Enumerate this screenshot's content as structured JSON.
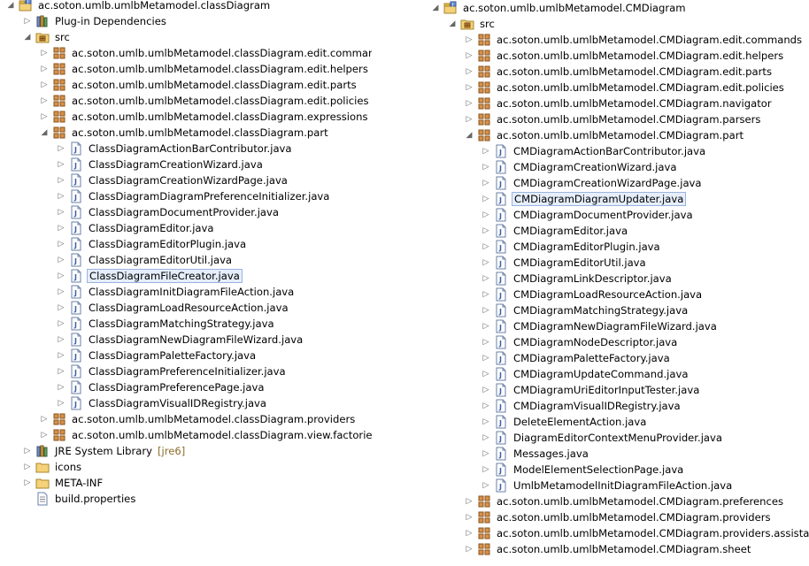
{
  "left": {
    "items": [
      {
        "depth": 0,
        "twisty": "expanded",
        "icon": "project",
        "label": "ac.soton.umlb.umlbMetamodel.classDiagram"
      },
      {
        "depth": 1,
        "twisty": "collapsed",
        "icon": "library",
        "label": "Plug-in Dependencies"
      },
      {
        "depth": 1,
        "twisty": "expanded",
        "icon": "source-folder",
        "label": "src"
      },
      {
        "depth": 2,
        "twisty": "collapsed",
        "icon": "package",
        "label": "ac.soton.umlb.umlbMetamodel.classDiagram.edit.commands"
      },
      {
        "depth": 2,
        "twisty": "collapsed",
        "icon": "package",
        "label": "ac.soton.umlb.umlbMetamodel.classDiagram.edit.helpers"
      },
      {
        "depth": 2,
        "twisty": "collapsed",
        "icon": "package",
        "label": "ac.soton.umlb.umlbMetamodel.classDiagram.edit.parts"
      },
      {
        "depth": 2,
        "twisty": "collapsed",
        "icon": "package",
        "label": "ac.soton.umlb.umlbMetamodel.classDiagram.edit.policies"
      },
      {
        "depth": 2,
        "twisty": "collapsed",
        "icon": "package",
        "label": "ac.soton.umlb.umlbMetamodel.classDiagram.expressions"
      },
      {
        "depth": 2,
        "twisty": "expanded",
        "icon": "package",
        "label": "ac.soton.umlb.umlbMetamodel.classDiagram.part"
      },
      {
        "depth": 3,
        "twisty": "collapsed",
        "icon": "java-file",
        "label": "ClassDiagramActionBarContributor.java"
      },
      {
        "depth": 3,
        "twisty": "collapsed",
        "icon": "java-file",
        "label": "ClassDiagramCreationWizard.java"
      },
      {
        "depth": 3,
        "twisty": "collapsed",
        "icon": "java-file",
        "label": "ClassDiagramCreationWizardPage.java"
      },
      {
        "depth": 3,
        "twisty": "collapsed",
        "icon": "java-file",
        "label": "ClassDiagramDiagramPreferenceInitializer.java"
      },
      {
        "depth": 3,
        "twisty": "collapsed",
        "icon": "java-file",
        "label": "ClassDiagramDocumentProvider.java"
      },
      {
        "depth": 3,
        "twisty": "collapsed",
        "icon": "java-file",
        "label": "ClassDiagramEditor.java"
      },
      {
        "depth": 3,
        "twisty": "collapsed",
        "icon": "java-file",
        "label": "ClassDiagramEditorPlugin.java"
      },
      {
        "depth": 3,
        "twisty": "collapsed",
        "icon": "java-file",
        "label": "ClassDiagramEditorUtil.java"
      },
      {
        "depth": 3,
        "twisty": "collapsed",
        "icon": "java-file",
        "label": "ClassDiagramFileCreator.java",
        "selected": true
      },
      {
        "depth": 3,
        "twisty": "collapsed",
        "icon": "java-file",
        "label": "ClassDiagramInitDiagramFileAction.java"
      },
      {
        "depth": 3,
        "twisty": "collapsed",
        "icon": "java-file",
        "label": "ClassDiagramLoadResourceAction.java"
      },
      {
        "depth": 3,
        "twisty": "collapsed",
        "icon": "java-file",
        "label": "ClassDiagramMatchingStrategy.java"
      },
      {
        "depth": 3,
        "twisty": "collapsed",
        "icon": "java-file",
        "label": "ClassDiagramNewDiagramFileWizard.java"
      },
      {
        "depth": 3,
        "twisty": "collapsed",
        "icon": "java-file",
        "label": "ClassDiagramPaletteFactory.java"
      },
      {
        "depth": 3,
        "twisty": "collapsed",
        "icon": "java-file",
        "label": "ClassDiagramPreferenceInitializer.java"
      },
      {
        "depth": 3,
        "twisty": "collapsed",
        "icon": "java-file",
        "label": "ClassDiagramPreferencePage.java"
      },
      {
        "depth": 3,
        "twisty": "collapsed",
        "icon": "java-file",
        "label": "ClassDiagramVisualIDRegistry.java"
      },
      {
        "depth": 2,
        "twisty": "collapsed",
        "icon": "package",
        "label": "ac.soton.umlb.umlbMetamodel.classDiagram.providers"
      },
      {
        "depth": 2,
        "twisty": "collapsed",
        "icon": "package",
        "label": "ac.soton.umlb.umlbMetamodel.classDiagram.view.factories"
      },
      {
        "depth": 1,
        "twisty": "collapsed",
        "icon": "library",
        "label": "JRE System Library",
        "extra": "[jre6]"
      },
      {
        "depth": 1,
        "twisty": "collapsed",
        "icon": "folder",
        "label": "icons"
      },
      {
        "depth": 1,
        "twisty": "collapsed",
        "icon": "folder",
        "label": "META-INF"
      },
      {
        "depth": 1,
        "twisty": "none",
        "icon": "properties-file",
        "label": "build.properties"
      }
    ]
  },
  "right": {
    "items": [
      {
        "depth": 0,
        "twisty": "expanded",
        "icon": "project",
        "label": "ac.soton.umlb.umlbMetamodel.CMDiagram"
      },
      {
        "depth": 1,
        "twisty": "expanded",
        "icon": "source-folder",
        "label": "src"
      },
      {
        "depth": 2,
        "twisty": "collapsed",
        "icon": "package",
        "label": "ac.soton.umlb.umlbMetamodel.CMDiagram.edit.commands"
      },
      {
        "depth": 2,
        "twisty": "collapsed",
        "icon": "package",
        "label": "ac.soton.umlb.umlbMetamodel.CMDiagram.edit.helpers"
      },
      {
        "depth": 2,
        "twisty": "collapsed",
        "icon": "package",
        "label": "ac.soton.umlb.umlbMetamodel.CMDiagram.edit.parts"
      },
      {
        "depth": 2,
        "twisty": "collapsed",
        "icon": "package",
        "label": "ac.soton.umlb.umlbMetamodel.CMDiagram.edit.policies"
      },
      {
        "depth": 2,
        "twisty": "collapsed",
        "icon": "package",
        "label": "ac.soton.umlb.umlbMetamodel.CMDiagram.navigator"
      },
      {
        "depth": 2,
        "twisty": "collapsed",
        "icon": "package",
        "label": "ac.soton.umlb.umlbMetamodel.CMDiagram.parsers"
      },
      {
        "depth": 2,
        "twisty": "expanded",
        "icon": "package",
        "label": "ac.soton.umlb.umlbMetamodel.CMDiagram.part"
      },
      {
        "depth": 3,
        "twisty": "collapsed",
        "icon": "java-file",
        "label": "CMDiagramActionBarContributor.java"
      },
      {
        "depth": 3,
        "twisty": "collapsed",
        "icon": "java-file",
        "label": "CMDiagramCreationWizard.java"
      },
      {
        "depth": 3,
        "twisty": "collapsed",
        "icon": "java-file",
        "label": "CMDiagramCreationWizardPage.java"
      },
      {
        "depth": 3,
        "twisty": "collapsed",
        "icon": "java-file",
        "label": "CMDiagramDiagramUpdater.java",
        "selected": true
      },
      {
        "depth": 3,
        "twisty": "collapsed",
        "icon": "java-file",
        "label": "CMDiagramDocumentProvider.java"
      },
      {
        "depth": 3,
        "twisty": "collapsed",
        "icon": "java-file",
        "label": "CMDiagramEditor.java"
      },
      {
        "depth": 3,
        "twisty": "collapsed",
        "icon": "java-file",
        "label": "CMDiagramEditorPlugin.java"
      },
      {
        "depth": 3,
        "twisty": "collapsed",
        "icon": "java-file",
        "label": "CMDiagramEditorUtil.java"
      },
      {
        "depth": 3,
        "twisty": "collapsed",
        "icon": "java-file",
        "label": "CMDiagramLinkDescriptor.java"
      },
      {
        "depth": 3,
        "twisty": "collapsed",
        "icon": "java-file",
        "label": "CMDiagramLoadResourceAction.java"
      },
      {
        "depth": 3,
        "twisty": "collapsed",
        "icon": "java-file",
        "label": "CMDiagramMatchingStrategy.java"
      },
      {
        "depth": 3,
        "twisty": "collapsed",
        "icon": "java-file",
        "label": "CMDiagramNewDiagramFileWizard.java"
      },
      {
        "depth": 3,
        "twisty": "collapsed",
        "icon": "java-file",
        "label": "CMDiagramNodeDescriptor.java"
      },
      {
        "depth": 3,
        "twisty": "collapsed",
        "icon": "java-file",
        "label": "CMDiagramPaletteFactory.java"
      },
      {
        "depth": 3,
        "twisty": "collapsed",
        "icon": "java-file",
        "label": "CMDiagramUpdateCommand.java"
      },
      {
        "depth": 3,
        "twisty": "collapsed",
        "icon": "java-file",
        "label": "CMDiagramUriEditorInputTester.java"
      },
      {
        "depth": 3,
        "twisty": "collapsed",
        "icon": "java-file",
        "label": "CMDiagramVisualIDRegistry.java"
      },
      {
        "depth": 3,
        "twisty": "collapsed",
        "icon": "java-file",
        "label": "DeleteElementAction.java"
      },
      {
        "depth": 3,
        "twisty": "collapsed",
        "icon": "java-file",
        "label": "DiagramEditorContextMenuProvider.java"
      },
      {
        "depth": 3,
        "twisty": "collapsed",
        "icon": "java-file",
        "label": "Messages.java"
      },
      {
        "depth": 3,
        "twisty": "collapsed",
        "icon": "java-file",
        "label": "ModelElementSelectionPage.java"
      },
      {
        "depth": 3,
        "twisty": "collapsed",
        "icon": "java-file",
        "label": "UmlbMetamodelInitDiagramFileAction.java"
      },
      {
        "depth": 2,
        "twisty": "collapsed",
        "icon": "package",
        "label": "ac.soton.umlb.umlbMetamodel.CMDiagram.preferences"
      },
      {
        "depth": 2,
        "twisty": "collapsed",
        "icon": "package",
        "label": "ac.soton.umlb.umlbMetamodel.CMDiagram.providers"
      },
      {
        "depth": 2,
        "twisty": "collapsed",
        "icon": "package",
        "label": "ac.soton.umlb.umlbMetamodel.CMDiagram.providers.assistants"
      },
      {
        "depth": 2,
        "twisty": "collapsed",
        "icon": "package",
        "label": "ac.soton.umlb.umlbMetamodel.CMDiagram.sheet"
      }
    ]
  }
}
